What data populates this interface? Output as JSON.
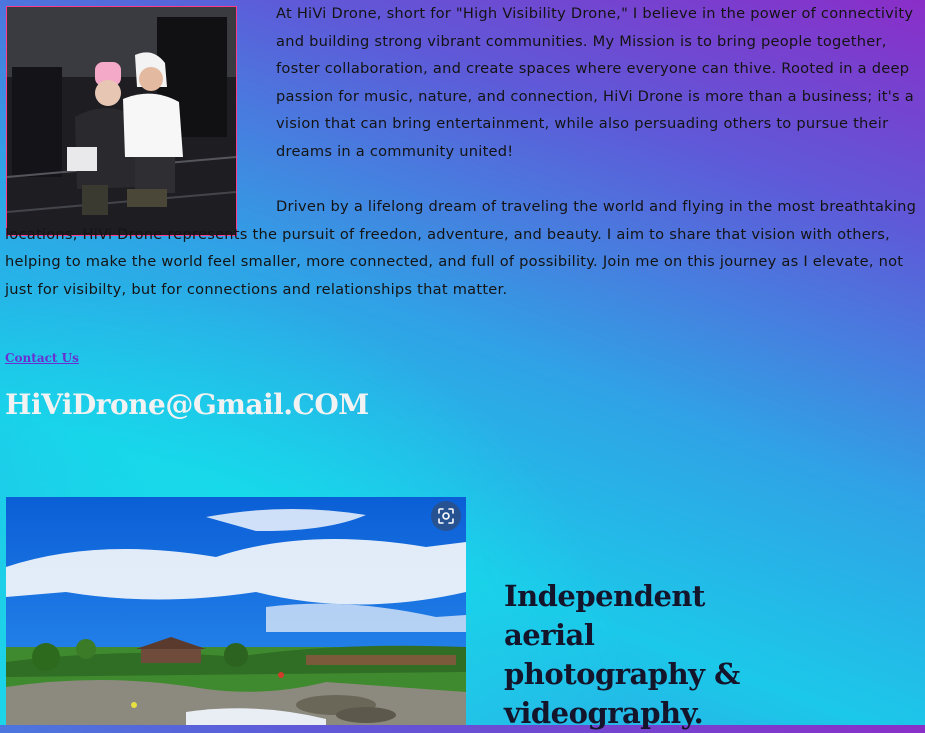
{
  "about": {
    "paragraph1": "At HiVi Drone, short for \"High Visibility Drone,\" I believe in the power of connectivity and building strong vibrant communities. My Mission is to bring people together, foster collaboration, and create spaces where everyone can thive. Rooted in a deep passion for music, nature, and connection, HiVi Drone is more than a business; it's a vision that can bring entertainment, while also persuading others to pursue their dreams in a community united!",
    "paragraph2": "Driven by a lifelong dream of traveling the world and flying in the most breathtaking locations, HiVi Drone represents the pursuit of freedon, adventure, and beauty. I aim to share that vision with others, helping to make the world feel smaller, more connected, and full of possibility. Join me on this journey as I elevate, not just for visibilty, but for connections and relationships that matter."
  },
  "contact": {
    "link_label": "Contact Us",
    "email": "HiViDrone@Gmail.COM"
  },
  "feature": {
    "tagline": "Independent aerial photography & videography."
  },
  "icons": {
    "lens": "google-lens-icon"
  },
  "colors": {
    "photo_border": "#ff3c8c",
    "link": "#6a2fd0",
    "email": "#f2f2f2",
    "tagline": "#14152b"
  }
}
